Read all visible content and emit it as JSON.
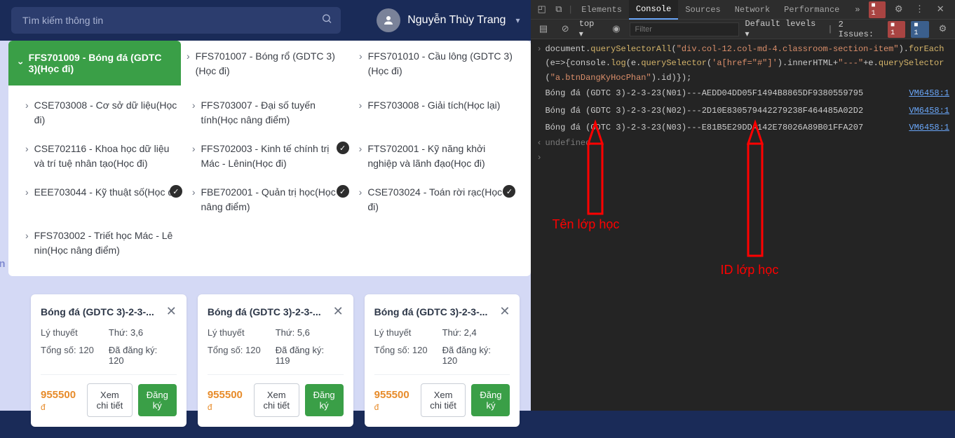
{
  "search": {
    "placeholder": "Tìm kiếm thông tin"
  },
  "user": {
    "name": "Nguyễn Thùy Trang"
  },
  "courseHead": {
    "chev": "›",
    "label": "FFS701009 - Bóng đá (GDTC 3)(Học đi)"
  },
  "courseHeadTop": [
    {
      "text": "FFS701007 - Bóng rổ (GDTC 3)(Học đi)"
    },
    {
      "text": "FFS701010 - Cầu lông (GDTC 3)(Học đi)"
    }
  ],
  "courses": [
    {
      "text": "CSE703008 - Cơ sở dữ liệu(Học đi)"
    },
    {
      "text": "FFS703007 - Đại số tuyến tính(Học nâng điểm)"
    },
    {
      "text": "FFS703008 - Giải tích(Học lại)"
    },
    {
      "text": "CSE702116 - Khoa học dữ liệu và trí tuệ nhân tạo(Học đi)"
    },
    {
      "text": "FFS702003 - Kinh tế chính trị Mác - Lênin(Học đi)",
      "check": true
    },
    {
      "text": "FTS702001 - Kỹ năng khởi nghiệp và lãnh đạo(Học đi)"
    },
    {
      "text": "EEE703044 - Kỹ thuật số(Học đi)",
      "check": true
    },
    {
      "text": "FBE702001 - Quản trị học(Học nâng điểm)",
      "check": true
    },
    {
      "text": "CSE703024 - Toán rời rạc(Học đi)",
      "check": true
    },
    {
      "text": "FFS703002 - Triết học Mác - Lê nin(Học nâng điểm)"
    }
  ],
  "partialLabel": "ần",
  "cards": [
    {
      "title": "Bóng đá (GDTC 3)-2-3-...",
      "l1": "Lý thuyết",
      "v1": "Thứ: 3,6",
      "l2": "Tổng số: 120",
      "v2l": "Đã đăng ký:",
      "v2v": "120",
      "price": "955500",
      "cur": "đ",
      "btn1": "Xem chi tiết",
      "btn2": "Đăng ký"
    },
    {
      "title": "Bóng đá (GDTC 3)-2-3-...",
      "l1": "Lý thuyết",
      "v1": "Thứ: 5,6",
      "l2": "Tổng số: 120",
      "v2l": "Đã đăng ký:",
      "v2v": "119",
      "price": "955500",
      "cur": "đ",
      "btn1": "Xem chi tiết",
      "btn2": "Đăng ký"
    },
    {
      "title": "Bóng đá (GDTC 3)-2-3-...",
      "l1": "Lý thuyết",
      "v1": "Thứ: 2,4",
      "l2": "Tổng số: 120",
      "v2l": "Đã đăng ký:",
      "v2v": "120",
      "price": "955500",
      "cur": "đ",
      "btn1": "Xem chi tiết",
      "btn2": "Đăng ký"
    }
  ],
  "devtools": {
    "tabs": [
      "Elements",
      "Console",
      "Sources",
      "Network",
      "Performance"
    ],
    "activeTab": "Console",
    "more": "»",
    "errBadge": "1",
    "top": "top ▾",
    "filterPh": "Filter",
    "levels": "Default levels ▾",
    "issues": "2 Issues:",
    "issueErr": "1",
    "issueInfo": "1",
    "codePrompt": "›",
    "codeReturn": "‹",
    "code": {
      "p1": "document.",
      "m1": "querySelectorAll",
      "p2": "(",
      "s1": "\"div.col-12.col-md-4.classroom-section-item\"",
      "p3": ").",
      "m2": "forEach",
      "p4": "(e=>{console.",
      "m3": "log",
      "p5": "(e.",
      "m4": "querySelector",
      "p6": "(",
      "s2": "'a[href=\"#\"]'",
      "p7": ").innerHTML+",
      "s3": "\"---\"",
      "p8": "+e.",
      "m5": "querySelector",
      "p9": "(",
      "s4": "\"a.btnDangKyHocPhan\"",
      "p10": ").id)});"
    },
    "logs": [
      {
        "text": "Bóng đá (GDTC 3)-2-3-23(N01)---AEDD04DD05F1494B8865DF9380559795",
        "src": "VM6458:1"
      },
      {
        "text": "Bóng đá (GDTC 3)-2-3-23(N02)---2D10E830579442279238F464485A02D2",
        "src": "VM6458:1"
      },
      {
        "text": "Bóng đá (GDTC 3)-2-3-23(N03)---E81B5E29DDA142E78026A89B01FFA207",
        "src": "VM6458:1"
      }
    ],
    "undef": "undefined"
  },
  "annotations": {
    "a1": "Tên lớp học",
    "a2": "ID lớp học"
  }
}
